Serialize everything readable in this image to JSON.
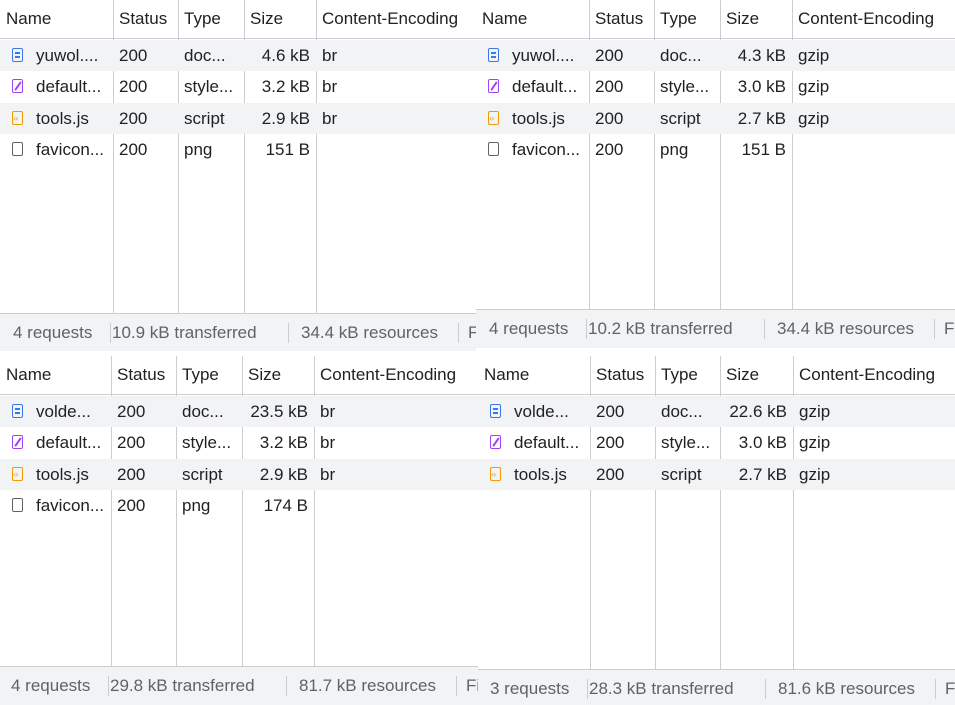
{
  "columns": {
    "name": "Name",
    "status": "Status",
    "type": "Type",
    "size": "Size",
    "encoding": "Content-Encoding"
  },
  "panels": {
    "top_left": {
      "rows": [
        {
          "icon": "document-icon",
          "name": "yuwol....",
          "status": "200",
          "type": "doc...",
          "size": "4.6 kB",
          "encoding": "br"
        },
        {
          "icon": "stylesheet-icon",
          "name": "default...",
          "status": "200",
          "type": "style...",
          "size": "3.2 kB",
          "encoding": "br"
        },
        {
          "icon": "script-icon",
          "name": "tools.js",
          "status": "200",
          "type": "script",
          "size": "2.9 kB",
          "encoding": "br"
        },
        {
          "icon": "image-icon",
          "name": "favicon...",
          "status": "200",
          "type": "png",
          "size": "151 B",
          "encoding": ""
        }
      ],
      "footer": {
        "requests": "4 requests",
        "transferred": "10.9 kB transferred",
        "resources": "34.4 kB resources",
        "more": "Fi"
      }
    },
    "top_right": {
      "rows": [
        {
          "icon": "document-icon",
          "name": "yuwol....",
          "status": "200",
          "type": "doc...",
          "size": "4.3 kB",
          "encoding": "gzip"
        },
        {
          "icon": "stylesheet-icon",
          "name": "default...",
          "status": "200",
          "type": "style...",
          "size": "3.0 kB",
          "encoding": "gzip"
        },
        {
          "icon": "script-icon",
          "name": "tools.js",
          "status": "200",
          "type": "script",
          "size": "2.7 kB",
          "encoding": "gzip"
        },
        {
          "icon": "image-icon",
          "name": "favicon...",
          "status": "200",
          "type": "png",
          "size": "151 B",
          "encoding": ""
        }
      ],
      "footer": {
        "requests": "4 requests",
        "transferred": "10.2 kB transferred",
        "resources": "34.4 kB resources",
        "more": "Fi"
      }
    },
    "bottom_left": {
      "rows": [
        {
          "icon": "document-icon",
          "name": "volde...",
          "status": "200",
          "type": "doc...",
          "size": "23.5 kB",
          "encoding": "br"
        },
        {
          "icon": "stylesheet-icon",
          "name": "default...",
          "status": "200",
          "type": "style...",
          "size": "3.2 kB",
          "encoding": "br"
        },
        {
          "icon": "script-icon",
          "name": "tools.js",
          "status": "200",
          "type": "script",
          "size": "2.9 kB",
          "encoding": "br"
        },
        {
          "icon": "image-icon",
          "name": "favicon...",
          "status": "200",
          "type": "png",
          "size": "174 B",
          "encoding": ""
        }
      ],
      "footer": {
        "requests": "4 requests",
        "transferred": "29.8 kB transferred",
        "resources": "81.7 kB resources",
        "more": "Fi"
      }
    },
    "bottom_right": {
      "rows": [
        {
          "icon": "document-icon",
          "name": "volde...",
          "status": "200",
          "type": "doc...",
          "size": "22.6 kB",
          "encoding": "gzip"
        },
        {
          "icon": "stylesheet-icon",
          "name": "default...",
          "status": "200",
          "type": "style...",
          "size": "3.0 kB",
          "encoding": "gzip"
        },
        {
          "icon": "script-icon",
          "name": "tools.js",
          "status": "200",
          "type": "script",
          "size": "2.7 kB",
          "encoding": "gzip"
        }
      ],
      "footer": {
        "requests": "3 requests",
        "transferred": "28.3 kB transferred",
        "resources": "81.6 kB resources",
        "more": "Fi"
      }
    }
  }
}
